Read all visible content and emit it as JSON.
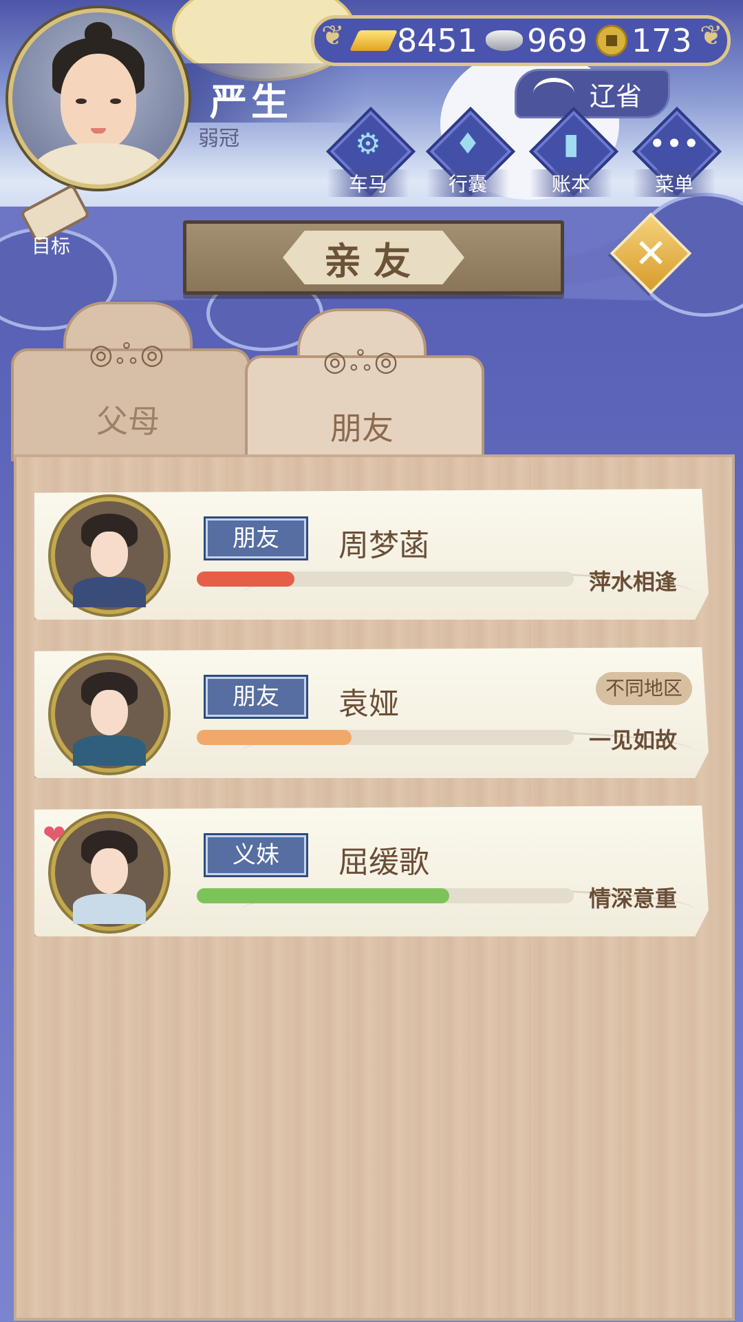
{
  "player": {
    "name": "严生",
    "rank": "弱冠"
  },
  "currency": {
    "gold": "8451",
    "silver": "969",
    "coins": "173"
  },
  "location": {
    "label": "辽省"
  },
  "menu": [
    {
      "label": "车马",
      "icon": "carriage-icon"
    },
    {
      "label": "行囊",
      "icon": "bundle-icon"
    },
    {
      "label": "账本",
      "icon": "ledger-icon"
    },
    {
      "label": "菜单",
      "icon": "menu-dots-icon"
    }
  ],
  "goal": {
    "label": "目标"
  },
  "title": "亲友",
  "tabs": [
    {
      "label": "父母",
      "active": false
    },
    {
      "label": "朋友",
      "active": true
    }
  ],
  "friends": [
    {
      "tag": "朋友",
      "name": "周梦菡",
      "relation": "萍水相逢",
      "bar_color": "#e55f48",
      "bar_fill": 0.26,
      "badge": null,
      "heart": false
    },
    {
      "tag": "朋友",
      "name": "袁娅",
      "relation": "一见如故",
      "bar_color": "#f0a96a",
      "bar_fill": 0.41,
      "badge": "不同地区",
      "heart": false
    },
    {
      "tag": "义妹",
      "name": "屈缓歌",
      "relation": "情深意重",
      "bar_color": "#7cc45a",
      "bar_fill": 0.67,
      "badge": null,
      "heart": true
    }
  ],
  "colors": {
    "accent_gold": "#dcc888",
    "panel_wood": "#dcc2a8",
    "tag_blue": "#566ea1"
  }
}
